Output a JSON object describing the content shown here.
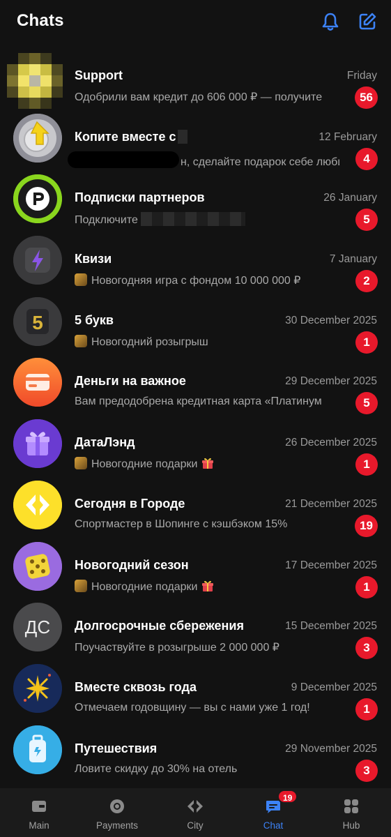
{
  "header": {
    "title": "Chats",
    "bell_icon": "bell-icon",
    "compose_icon": "compose-icon",
    "accent": "#3c82f6"
  },
  "chats": [
    {
      "name": "Support",
      "preview": "Одобрили вам кредит до 606 000 ₽ — получите",
      "date": "Friday",
      "unread": "56"
    },
    {
      "name": "Копите вместе с",
      "preview": "н, сделайте подарок себе любим",
      "date": "12 February",
      "unread": "4"
    },
    {
      "name": "Подписки партнеров",
      "preview": "Подключите",
      "date": "26 January",
      "unread": "5"
    },
    {
      "name": "Квизи",
      "preview": "Новогодняя игра с фондом 10 000 000 ₽",
      "date": "7 January",
      "unread": "2"
    },
    {
      "name": "5 букв",
      "preview": "Новогодний розыгрыш",
      "date": "30 December 2025",
      "unread": "1"
    },
    {
      "name": "Деньги на важное",
      "preview": "Вам предодобрена кредитная карта «Платинум",
      "date": "29 December 2025",
      "unread": "5"
    },
    {
      "name": "ДатаЛэнд",
      "preview": "Новогодние подарки",
      "date": "26 December 2025",
      "unread": "1"
    },
    {
      "name": "Сегодня в Городе",
      "preview": "Спортмастер в Шопинге с кэшбэком 15%",
      "date": "21 December 2025",
      "unread": "19"
    },
    {
      "name": "Новогодний сезон",
      "preview": "Новогодние подарки",
      "date": "17 December 2025",
      "unread": "1"
    },
    {
      "name": "Долгосрочные сбережения",
      "preview": "Поучаствуйте в розыгрыше 2 000 000 ₽",
      "date": "15 December 2025",
      "unread": "3",
      "avatar_text": "ДС"
    },
    {
      "name": "Вместе сквозь года",
      "preview": "Отмечаем годовщину — вы с нами уже 1 год!",
      "date": "9 December 2025",
      "unread": "1"
    },
    {
      "name": "Путешествия",
      "preview": "Ловите скидку до 30% на отель",
      "date": "29 November 2025",
      "unread": "3"
    }
  ],
  "tabbar": {
    "main": "Main",
    "payments": "Payments",
    "city": "City",
    "chat": "Chat",
    "chat_badge": "19",
    "hub": "Hub"
  },
  "colors": {
    "badge": "#e8192b",
    "background": "#121212",
    "active_tab": "#3c82f6"
  }
}
